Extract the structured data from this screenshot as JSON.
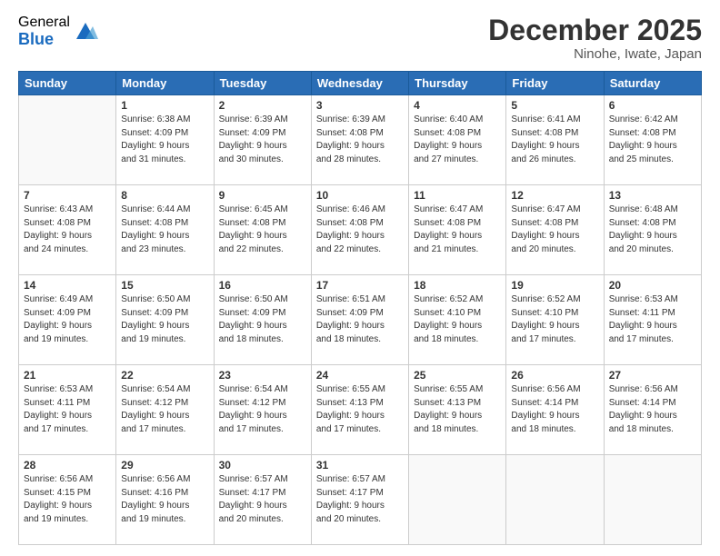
{
  "logo": {
    "general": "General",
    "blue": "Blue"
  },
  "header": {
    "month": "December 2025",
    "location": "Ninohe, Iwate, Japan"
  },
  "weekdays": [
    "Sunday",
    "Monday",
    "Tuesday",
    "Wednesday",
    "Thursday",
    "Friday",
    "Saturday"
  ],
  "weeks": [
    [
      {
        "day": "",
        "info": ""
      },
      {
        "day": "1",
        "info": "Sunrise: 6:38 AM\nSunset: 4:09 PM\nDaylight: 9 hours\nand 31 minutes."
      },
      {
        "day": "2",
        "info": "Sunrise: 6:39 AM\nSunset: 4:09 PM\nDaylight: 9 hours\nand 30 minutes."
      },
      {
        "day": "3",
        "info": "Sunrise: 6:39 AM\nSunset: 4:08 PM\nDaylight: 9 hours\nand 28 minutes."
      },
      {
        "day": "4",
        "info": "Sunrise: 6:40 AM\nSunset: 4:08 PM\nDaylight: 9 hours\nand 27 minutes."
      },
      {
        "day": "5",
        "info": "Sunrise: 6:41 AM\nSunset: 4:08 PM\nDaylight: 9 hours\nand 26 minutes."
      },
      {
        "day": "6",
        "info": "Sunrise: 6:42 AM\nSunset: 4:08 PM\nDaylight: 9 hours\nand 25 minutes."
      }
    ],
    [
      {
        "day": "7",
        "info": "Sunrise: 6:43 AM\nSunset: 4:08 PM\nDaylight: 9 hours\nand 24 minutes."
      },
      {
        "day": "8",
        "info": "Sunrise: 6:44 AM\nSunset: 4:08 PM\nDaylight: 9 hours\nand 23 minutes."
      },
      {
        "day": "9",
        "info": "Sunrise: 6:45 AM\nSunset: 4:08 PM\nDaylight: 9 hours\nand 22 minutes."
      },
      {
        "day": "10",
        "info": "Sunrise: 6:46 AM\nSunset: 4:08 PM\nDaylight: 9 hours\nand 22 minutes."
      },
      {
        "day": "11",
        "info": "Sunrise: 6:47 AM\nSunset: 4:08 PM\nDaylight: 9 hours\nand 21 minutes."
      },
      {
        "day": "12",
        "info": "Sunrise: 6:47 AM\nSunset: 4:08 PM\nDaylight: 9 hours\nand 20 minutes."
      },
      {
        "day": "13",
        "info": "Sunrise: 6:48 AM\nSunset: 4:08 PM\nDaylight: 9 hours\nand 20 minutes."
      }
    ],
    [
      {
        "day": "14",
        "info": "Sunrise: 6:49 AM\nSunset: 4:09 PM\nDaylight: 9 hours\nand 19 minutes."
      },
      {
        "day": "15",
        "info": "Sunrise: 6:50 AM\nSunset: 4:09 PM\nDaylight: 9 hours\nand 19 minutes."
      },
      {
        "day": "16",
        "info": "Sunrise: 6:50 AM\nSunset: 4:09 PM\nDaylight: 9 hours\nand 18 minutes."
      },
      {
        "day": "17",
        "info": "Sunrise: 6:51 AM\nSunset: 4:09 PM\nDaylight: 9 hours\nand 18 minutes."
      },
      {
        "day": "18",
        "info": "Sunrise: 6:52 AM\nSunset: 4:10 PM\nDaylight: 9 hours\nand 18 minutes."
      },
      {
        "day": "19",
        "info": "Sunrise: 6:52 AM\nSunset: 4:10 PM\nDaylight: 9 hours\nand 17 minutes."
      },
      {
        "day": "20",
        "info": "Sunrise: 6:53 AM\nSunset: 4:11 PM\nDaylight: 9 hours\nand 17 minutes."
      }
    ],
    [
      {
        "day": "21",
        "info": "Sunrise: 6:53 AM\nSunset: 4:11 PM\nDaylight: 9 hours\nand 17 minutes."
      },
      {
        "day": "22",
        "info": "Sunrise: 6:54 AM\nSunset: 4:12 PM\nDaylight: 9 hours\nand 17 minutes."
      },
      {
        "day": "23",
        "info": "Sunrise: 6:54 AM\nSunset: 4:12 PM\nDaylight: 9 hours\nand 17 minutes."
      },
      {
        "day": "24",
        "info": "Sunrise: 6:55 AM\nSunset: 4:13 PM\nDaylight: 9 hours\nand 17 minutes."
      },
      {
        "day": "25",
        "info": "Sunrise: 6:55 AM\nSunset: 4:13 PM\nDaylight: 9 hours\nand 18 minutes."
      },
      {
        "day": "26",
        "info": "Sunrise: 6:56 AM\nSunset: 4:14 PM\nDaylight: 9 hours\nand 18 minutes."
      },
      {
        "day": "27",
        "info": "Sunrise: 6:56 AM\nSunset: 4:14 PM\nDaylight: 9 hours\nand 18 minutes."
      }
    ],
    [
      {
        "day": "28",
        "info": "Sunrise: 6:56 AM\nSunset: 4:15 PM\nDaylight: 9 hours\nand 19 minutes."
      },
      {
        "day": "29",
        "info": "Sunrise: 6:56 AM\nSunset: 4:16 PM\nDaylight: 9 hours\nand 19 minutes."
      },
      {
        "day": "30",
        "info": "Sunrise: 6:57 AM\nSunset: 4:17 PM\nDaylight: 9 hours\nand 20 minutes."
      },
      {
        "day": "31",
        "info": "Sunrise: 6:57 AM\nSunset: 4:17 PM\nDaylight: 9 hours\nand 20 minutes."
      },
      {
        "day": "",
        "info": ""
      },
      {
        "day": "",
        "info": ""
      },
      {
        "day": "",
        "info": ""
      }
    ]
  ]
}
